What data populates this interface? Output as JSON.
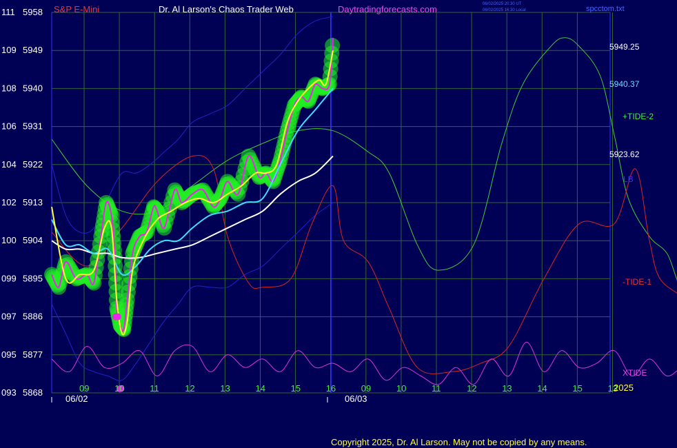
{
  "header": {
    "instrument": "S&P E-Mini",
    "site_title": "Dr. Al Larson's Chaos Trader Web",
    "site_url": "Daytradingforecasts.com",
    "time_utc": "06/02/2025 20:30 UT",
    "time_local": "06/02/2025 16:30 Local",
    "chart_file": "spcctom.txt"
  },
  "footer": {
    "copyright": "Copyright 2025, Dr. Al Larson. May not be copied by any means.",
    "year": "2025"
  },
  "chart_data": {
    "type": "line",
    "y_axis": {
      "left_ticks": [
        {
          "tide": "111",
          "price": "5958"
        },
        {
          "tide": "109",
          "price": "5949"
        },
        {
          "tide": "108",
          "price": "5940"
        },
        {
          "tide": "106",
          "price": "5931"
        },
        {
          "tide": "104",
          "price": "5922"
        },
        {
          "tide": "102",
          "price": "5913"
        },
        {
          "tide": "100",
          "price": "5904"
        },
        {
          "tide": "099",
          "price": "5895"
        },
        {
          "tide": "097",
          "price": "5886"
        },
        {
          "tide": "095",
          "price": "5877"
        },
        {
          "tide": "093",
          "price": "5868"
        }
      ],
      "price_range": [
        5868,
        5958
      ]
    },
    "x_axis": {
      "hour_ticks": [
        "09",
        "10",
        "11",
        "12",
        "13",
        "14",
        "15",
        "16",
        "09",
        "10",
        "11",
        "12",
        "13",
        "14",
        "15",
        "13"
      ],
      "dates": [
        "06/02",
        "06/03"
      ],
      "hour_range": [
        8.0,
        16.0
      ]
    },
    "grid": true,
    "right_labels": [
      {
        "text": "5949.25",
        "color": "#ffffff"
      },
      {
        "text": "5940.37",
        "color": "#66ddff"
      },
      {
        "text": "+TIDE-2",
        "color": "#44ee44"
      },
      {
        "text": "5923.62",
        "color": "#ffffff"
      },
      {
        "text": "LB",
        "color": "#3333ff"
      },
      {
        "text": "-TIDE-1",
        "color": "#ee3333"
      },
      {
        "text": "XTIDE",
        "color": "#ee44ee"
      }
    ],
    "colors": {
      "background": "#000055",
      "plot_border": "#3333ff",
      "grid": "#336633",
      "price": "#ee22ee",
      "price_highlight": "#22ee22",
      "ema_fast": "#ffff33",
      "ema_mid": "#44ddff",
      "ema_slow": "#ffffff",
      "band": "#2222cc",
      "tide_plus": "#44cc33",
      "tide_minus": "#dd2222",
      "xtide": "#dd33dd",
      "title_red": "#ee3333",
      "title_white": "#ffffff",
      "title_magenta": "#ee44ee",
      "axis_green": "#44ee44"
    },
    "series": [
      {
        "name": "S&P E-Mini",
        "day": "06/02",
        "hours": [
          8.0,
          8.2,
          8.4,
          8.7,
          9.0,
          9.2,
          9.4,
          9.55,
          9.7,
          9.8,
          9.85,
          9.95,
          10.05,
          10.15,
          10.3,
          10.5,
          10.7,
          10.9,
          11.0,
          11.2,
          11.5,
          11.7,
          12.0,
          12.3,
          12.6,
          12.8,
          13.0,
          13.3,
          13.6,
          13.9,
          14.1,
          14.3,
          14.5,
          14.7,
          14.9,
          15.1,
          15.3,
          15.5,
          15.7,
          15.9,
          16.0
        ],
        "prices": [
          5896,
          5893,
          5899,
          5895,
          5896,
          5894,
          5905,
          5913,
          5910,
          5900,
          5888,
          5884,
          5883,
          5890,
          5901,
          5905,
          5906,
          5912,
          5911,
          5907,
          5916,
          5913,
          5915,
          5916,
          5912,
          5914,
          5918,
          5915,
          5924,
          5919,
          5920,
          5918,
          5923,
          5930,
          5936,
          5938,
          5937,
          5941,
          5940,
          5941,
          5952
        ]
      },
      {
        "name": "EMA fast",
        "hours": [
          8.0,
          8.4,
          8.8,
          9.2,
          9.5,
          9.7,
          9.85,
          10.0,
          10.15,
          10.3,
          10.6,
          11.0,
          11.4,
          11.8,
          12.2,
          12.6,
          13.0,
          13.4,
          13.8,
          14.1,
          14.4,
          14.7,
          15.0,
          15.3,
          15.6,
          15.8,
          16.0
        ],
        "prices": [
          5912,
          5895,
          5896,
          5897,
          5907,
          5907,
          5890,
          5882,
          5885,
          5897,
          5904,
          5909,
          5911,
          5913,
          5914,
          5913,
          5915,
          5917,
          5920,
          5920,
          5922,
          5932,
          5937,
          5940,
          5942,
          5941,
          5949
        ]
      },
      {
        "name": "EMA mid",
        "hours": [
          8.0,
          8.4,
          8.8,
          9.2,
          9.6,
          10.0,
          10.4,
          10.8,
          11.2,
          11.6,
          12.0,
          12.5,
          13.0,
          13.5,
          14.0,
          14.5,
          15.0,
          15.5,
          16.0
        ],
        "prices": [
          5909,
          5903,
          5903,
          5901,
          5902,
          5896,
          5898,
          5902,
          5904,
          5904,
          5907,
          5910,
          5911,
          5913,
          5914,
          5922,
          5930,
          5935,
          5940
        ]
      },
      {
        "name": "EMA slow",
        "hours": [
          8.0,
          8.4,
          8.8,
          9.2,
          9.6,
          10.0,
          10.5,
          11.0,
          11.5,
          12.0,
          12.5,
          13.0,
          13.5,
          14.0,
          14.5,
          15.0,
          15.5,
          16.0
        ],
        "prices": [
          5904,
          5902,
          5902,
          5901,
          5901,
          5900,
          5900,
          5901,
          5902,
          5903,
          5905,
          5907,
          5909,
          5911,
          5915,
          5918,
          5920,
          5924
        ]
      },
      {
        "name": "Upper band",
        "hours": [
          8.0,
          8.4,
          8.8,
          9.2,
          9.6,
          10.0,
          10.4,
          10.8,
          11.2,
          11.6,
          12.0,
          12.5,
          13.0,
          13.5,
          14.0,
          14.5,
          15.0,
          15.5,
          16.0
        ],
        "prices": [
          5922,
          5910,
          5906,
          5907,
          5914,
          5920,
          5920,
          5922,
          5925,
          5928,
          5932,
          5934,
          5936,
          5940,
          5944,
          5948,
          5953,
          5956,
          5957
        ]
      },
      {
        "name": "Lower band",
        "hours": [
          8.0,
          8.4,
          8.8,
          9.2,
          9.6,
          10.0,
          10.4,
          10.8,
          11.2,
          11.6,
          12.0,
          12.5,
          13.0,
          13.5,
          14.0,
          14.5,
          15.0,
          15.5,
          16.0
        ],
        "prices": [
          5889,
          5882,
          5875,
          5873,
          5872,
          5871,
          5875,
          5880,
          5885,
          5889,
          5893,
          5893,
          5893,
          5896,
          5898,
          5902,
          5906,
          5910,
          5913
        ]
      },
      {
        "name": "+TIDE-2",
        "span": "two-day",
        "hours": [
          8.0,
          9.0,
          10.0,
          11.0,
          12.0,
          13.0,
          14.0,
          15.0,
          16.0,
          17.0,
          17.6,
          18.4,
          19.0,
          20.0,
          20.8,
          21.4,
          22.2,
          22.6,
          23.0,
          23.6,
          24.0,
          24.4,
          25.0,
          25.5,
          26.0,
          26.5,
          27.0,
          27.8,
          28.2
        ],
        "prices": [
          5928,
          5917,
          5911,
          5911,
          5917,
          5923,
          5927,
          5930,
          5930,
          5925,
          5920,
          5903,
          5897,
          5903,
          5927,
          5941,
          5950,
          5952,
          5950,
          5943,
          5929,
          5914,
          5905,
          5901,
          5893,
          5912,
          5925,
          5937,
          5934
        ]
      },
      {
        "name": "-TIDE-1",
        "span": "two-day",
        "hours": [
          8.0,
          9.0,
          10.0,
          11.0,
          12.0,
          12.6,
          13.0,
          13.6,
          14.0,
          14.8,
          15.4,
          16.0,
          16.3,
          17.0,
          17.6,
          18.4,
          19.4,
          20.2,
          21.0,
          22.0,
          23.0,
          24.0,
          24.6,
          25.0,
          25.3,
          26.0,
          26.4,
          27.0,
          28.2
        ],
        "prices": [
          5906,
          5898,
          5907,
          5918,
          5924,
          5921,
          5905,
          5894,
          5893,
          5895,
          5908,
          5917,
          5904,
          5899,
          5888,
          5874,
          5873,
          5875,
          5879,
          5895,
          5908,
          5908,
          5921,
          5904,
          5895,
          5890,
          5883,
          5887,
          5891
        ]
      },
      {
        "name": "XTIDE",
        "span": "two-day",
        "hours": [
          8.0,
          8.5,
          9.0,
          9.5,
          10.0,
          10.5,
          11.0,
          11.5,
          12.0,
          12.5,
          13.0,
          13.5,
          14.0,
          14.5,
          15.0,
          15.5,
          16.0,
          16.5,
          17.0,
          17.5,
          18.0,
          18.5,
          19.0,
          19.5,
          20.0,
          20.5,
          21.0,
          21.5,
          22.0,
          22.5,
          23.0,
          23.5,
          24.0,
          24.5,
          25.0,
          25.5,
          26.0,
          26.5,
          27.0,
          27.5,
          28.0
        ],
        "prices": [
          5876,
          5873,
          5879,
          5874,
          5875,
          5878,
          5872,
          5878,
          5879,
          5873,
          5877,
          5874,
          5876,
          5873,
          5878,
          5874,
          5875,
          5873,
          5876,
          5871,
          5874,
          5872,
          5870,
          5874,
          5870,
          5876,
          5872,
          5880,
          5873,
          5878,
          5874,
          5875,
          5878,
          5872,
          5876,
          5872,
          5874,
          5870,
          5873,
          5870,
          5873
        ]
      }
    ],
    "markers": [
      {
        "hour": 9.82,
        "price": 5886,
        "kind": "magenta-dot"
      },
      {
        "hour": 9.88,
        "price": 5886,
        "kind": "magenta-dot"
      },
      {
        "hour": 9.95,
        "price": 5869,
        "kind": "magenta-dot"
      }
    ]
  }
}
